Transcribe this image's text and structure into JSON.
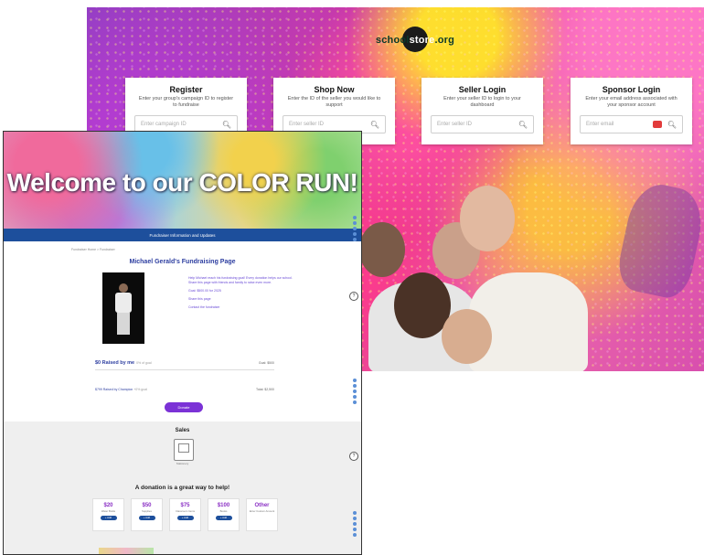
{
  "portal": {
    "logo": {
      "left": "school",
      "mid": "store",
      "right": ".org"
    },
    "cards": [
      {
        "title": "Register",
        "subtitle": "Enter your group's campaign ID to register to fundraise",
        "placeholder": "Enter campaign ID",
        "has_pill": false
      },
      {
        "title": "Shop Now",
        "subtitle": "Enter the ID of the seller you would like to support",
        "placeholder": "Enter seller ID",
        "has_pill": false
      },
      {
        "title": "Seller Login",
        "subtitle": "Enter your seller ID to login to your dashboard",
        "placeholder": "Enter seller ID",
        "has_pill": false
      },
      {
        "title": "Sponsor Login",
        "subtitle": "Enter your email address associated with your sponsor account",
        "placeholder": "Enter email",
        "has_pill": true
      }
    ]
  },
  "fundraiser": {
    "banner_title": "Welcome to our COLOR RUN!",
    "nav_text": "Fundraiser Information and Updates",
    "breadcrumb": "Fundraiser Home > Fundraiser",
    "page_title": "Michael Gerald's Fundraising Page",
    "info_lines": [
      "Help Michael reach his fundraising goal! Every donation helps our school.",
      "Share this page with friends and family to raise even more.",
      "",
      "Goal: $500.00 for 2025",
      "",
      "Share this page",
      "",
      "Contact the fundraiser"
    ],
    "raised_label": "$0 Raised by me",
    "raised_sub": "0% of goal",
    "raised_amount": "Goal: $500",
    "raised2_label": "$799 Raised by Champion",
    "raised2_sub": "+0% goal",
    "raised2_amount": "Total: $2,500",
    "donate_button": "Donate",
    "sales_title": "Sales",
    "sales_caption": "Stationery",
    "donate_heading": "A donation is a great way to help!",
    "tiles": [
      {
        "amount": "$20",
        "caption": "Water Bottle",
        "button": "+ Add"
      },
      {
        "amount": "$50",
        "caption": "Supplies",
        "button": "+ Add"
      },
      {
        "amount": "$75",
        "caption": "Classroom Items",
        "button": "+ Add"
      },
      {
        "amount": "$100",
        "caption": "Books",
        "button": "+ Add"
      },
      {
        "amount": "Other",
        "caption": "Enter Custom Amount",
        "button": ""
      }
    ]
  }
}
